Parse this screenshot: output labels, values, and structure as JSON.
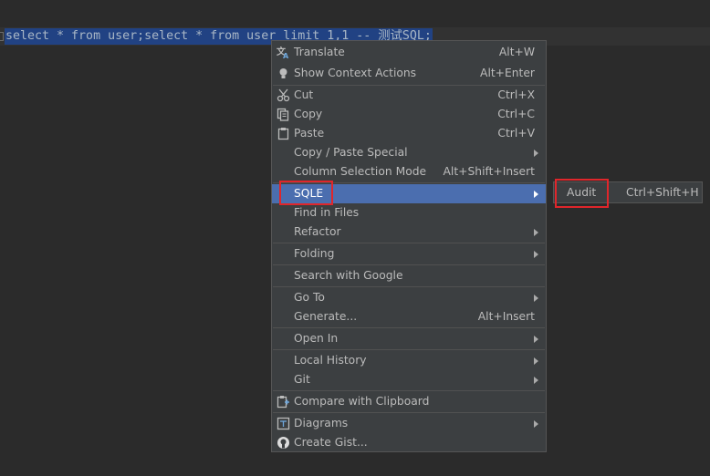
{
  "editor": {
    "code": "select * from user;select * from user limit 1,1 -- 测试SQL;"
  },
  "context_menu": {
    "items": [
      {
        "label": "Translate",
        "shortcut": "Alt+W",
        "icon": "translate-icon"
      },
      {
        "label": "Show Context Actions",
        "shortcut": "Alt+Enter",
        "icon": "lightbulb-icon"
      },
      {
        "label": "Cut",
        "shortcut": "Ctrl+X",
        "icon": "scissors-icon"
      },
      {
        "label": "Copy",
        "shortcut": "Ctrl+C",
        "icon": "copy-icon"
      },
      {
        "label": "Paste",
        "shortcut": "Ctrl+V",
        "icon": "clipboard-icon"
      },
      {
        "label": "Copy / Paste Special",
        "shortcut": "",
        "submenu": true
      },
      {
        "label": "Column Selection Mode",
        "shortcut": "Alt+Shift+Insert"
      },
      {
        "label": "SQLE",
        "shortcut": "",
        "submenu": true,
        "selected": true
      },
      {
        "label": "Find in Files",
        "shortcut": ""
      },
      {
        "label": "Refactor",
        "shortcut": "",
        "submenu": true
      },
      {
        "label": "Folding",
        "shortcut": "",
        "submenu": true
      },
      {
        "label": "Search with Google",
        "shortcut": ""
      },
      {
        "label": "Go To",
        "shortcut": "",
        "submenu": true
      },
      {
        "label": "Generate...",
        "shortcut": "Alt+Insert"
      },
      {
        "label": "Open In",
        "shortcut": "",
        "submenu": true
      },
      {
        "label": "Local History",
        "shortcut": "",
        "submenu": true
      },
      {
        "label": "Git",
        "shortcut": "",
        "submenu": true
      },
      {
        "label": "Compare with Clipboard",
        "shortcut": "",
        "icon": "compare-clipboard-icon"
      },
      {
        "label": "Diagrams",
        "shortcut": "",
        "submenu": true,
        "icon": "diagram-icon"
      },
      {
        "label": "Create Gist...",
        "shortcut": "",
        "icon": "github-icon"
      }
    ]
  },
  "submenu": {
    "items": [
      {
        "label": "Audit",
        "shortcut": "Ctrl+Shift+H"
      }
    ]
  },
  "colors": {
    "editor_background": "#2b2b2b",
    "selection": "#214283",
    "menu_background": "#3c3f41",
    "menu_selected": "#4b6eaf",
    "annotation_red": "#e0262b"
  }
}
